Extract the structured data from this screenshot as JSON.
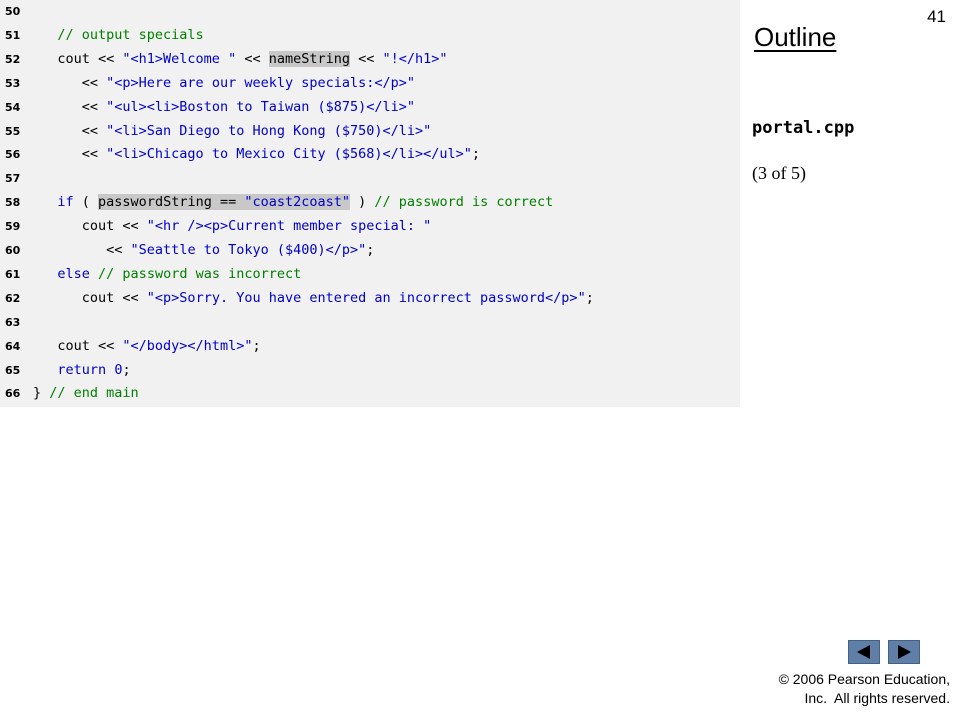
{
  "slide": {
    "number": "41",
    "outline_title": "Outline",
    "file_name": "portal.cpp",
    "page_indicator": "(3 of 5)",
    "copyright_line1": "© 2006 Pearson Education,",
    "copyright_line2": "Inc.  All rights reserved."
  },
  "code": [
    {
      "num": "50",
      "tokens": []
    },
    {
      "num": "51",
      "tokens": [
        {
          "t": "   "
        },
        {
          "t": "// output specials",
          "c": "cm"
        }
      ]
    },
    {
      "num": "52",
      "tokens": [
        {
          "t": "   cout << "
        },
        {
          "t": "\"<h1>Welcome \"",
          "c": "st"
        },
        {
          "t": " << "
        },
        {
          "t": "nameString",
          "c": "hl"
        },
        {
          "t": " << "
        },
        {
          "t": "\"!</h1>\"",
          "c": "st"
        }
      ]
    },
    {
      "num": "53",
      "tokens": [
        {
          "t": "      << "
        },
        {
          "t": "\"<p>Here are our weekly specials:</p>\"",
          "c": "st"
        }
      ]
    },
    {
      "num": "54",
      "tokens": [
        {
          "t": "      << "
        },
        {
          "t": "\"<ul><li>Boston to Taiwan ($875)</li>\"",
          "c": "st"
        }
      ]
    },
    {
      "num": "55",
      "tokens": [
        {
          "t": "      << "
        },
        {
          "t": "\"<li>San Diego to Hong Kong ($750)</li>\"",
          "c": "st"
        }
      ]
    },
    {
      "num": "56",
      "tokens": [
        {
          "t": "      << "
        },
        {
          "t": "\"<li>Chicago to Mexico City ($568)</li></ul>\"",
          "c": "st"
        },
        {
          "t": ";"
        }
      ]
    },
    {
      "num": "57",
      "tokens": []
    },
    {
      "num": "58",
      "tokens": [
        {
          "t": "   "
        },
        {
          "t": "if",
          "c": "kw"
        },
        {
          "t": " ( "
        },
        {
          "t": "passwordString == ",
          "c": "hl"
        },
        {
          "t": "\"coast2coast\"",
          "c": "hlst"
        },
        {
          "t": " ) "
        },
        {
          "t": "// password is correct",
          "c": "cm"
        }
      ]
    },
    {
      "num": "59",
      "tokens": [
        {
          "t": "      cout << "
        },
        {
          "t": "\"<hr /><p>Current member special: \"",
          "c": "st"
        }
      ]
    },
    {
      "num": "60",
      "tokens": [
        {
          "t": "         << "
        },
        {
          "t": "\"Seattle to Tokyo ($400)</p>\"",
          "c": "st"
        },
        {
          "t": ";"
        }
      ]
    },
    {
      "num": "61",
      "tokens": [
        {
          "t": "   "
        },
        {
          "t": "else",
          "c": "kw"
        },
        {
          "t": " "
        },
        {
          "t": "// password was incorrect",
          "c": "cm"
        }
      ]
    },
    {
      "num": "62",
      "tokens": [
        {
          "t": "      cout << "
        },
        {
          "t": "\"<p>Sorry. You have entered an incorrect password</p>\"",
          "c": "st"
        },
        {
          "t": ";"
        }
      ]
    },
    {
      "num": "63",
      "tokens": []
    },
    {
      "num": "64",
      "tokens": [
        {
          "t": "   cout << "
        },
        {
          "t": "\"</body></html>\"",
          "c": "st"
        },
        {
          "t": ";"
        }
      ]
    },
    {
      "num": "65",
      "tokens": [
        {
          "t": "   "
        },
        {
          "t": "return",
          "c": "kw"
        },
        {
          "t": " "
        },
        {
          "t": "0",
          "c": "num"
        },
        {
          "t": ";"
        }
      ]
    },
    {
      "num": "66",
      "tokens": [
        {
          "t": "} "
        },
        {
          "t": "// end main",
          "c": "cm"
        }
      ]
    }
  ],
  "nav": {
    "back_icon": "triangle-left-icon",
    "forward_icon": "triangle-right-icon"
  }
}
